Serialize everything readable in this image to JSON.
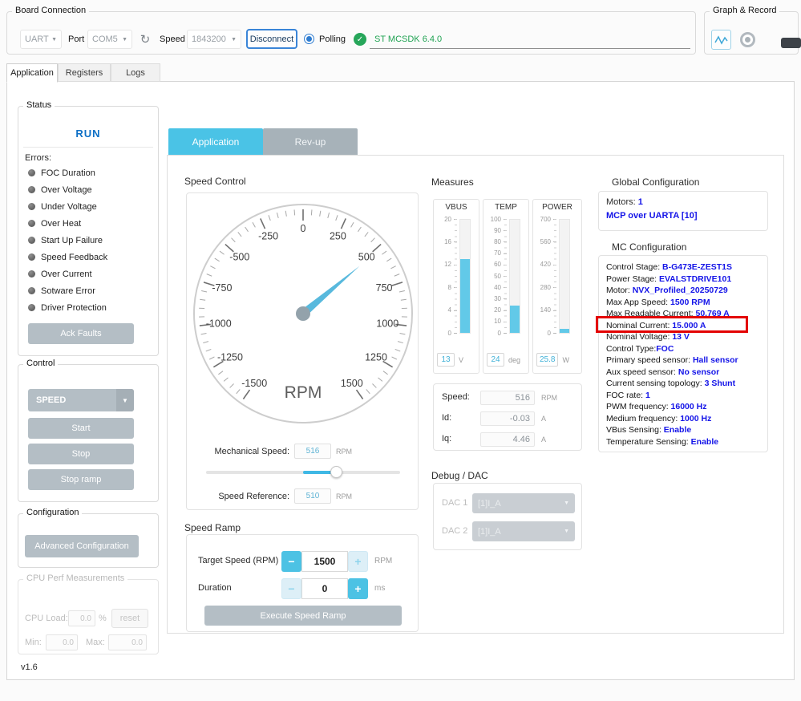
{
  "board_connection": {
    "title": "Board Connection",
    "uart": "UART",
    "port_label": "Port",
    "port_value": "COM5",
    "speed_label": "Speed",
    "speed_value": "1843200",
    "disconnect": "Disconnect",
    "polling": "Polling",
    "firmware": "ST MCSDK 6.4.0"
  },
  "graph_record": {
    "title": "Graph & Record"
  },
  "main_tabs": [
    {
      "label": "Application"
    },
    {
      "label": "Registers"
    },
    {
      "label": "Logs"
    }
  ],
  "status": {
    "title": "Status",
    "state": "RUN",
    "errors_label": "Errors:",
    "errors": [
      "FOC Duration",
      "Over Voltage",
      "Under Voltage",
      "Over Heat",
      "Start Up Failure",
      "Speed Feedback",
      "Over Current",
      "Sotware Error",
      "Driver Protection"
    ],
    "ack_button": "Ack Faults"
  },
  "control": {
    "title": "Control",
    "mode": "SPEED",
    "start": "Start",
    "stop": "Stop",
    "stop_ramp": "Stop ramp"
  },
  "configuration": {
    "title": "Configuration",
    "advanced_button": "Advanced Configuration"
  },
  "cpu_perf": {
    "title": "CPU Perf Measurements",
    "load_label": "CPU Load:",
    "load_value": "0.0",
    "percent": "%",
    "reset": "reset",
    "min_label": "Min:",
    "min_value": "0.0",
    "max_label": "Max:",
    "max_value": "0.0"
  },
  "version": "v1.6",
  "center_tabs": [
    {
      "label": "Application"
    },
    {
      "label": "Rev-up"
    }
  ],
  "speed_control": {
    "title": "Speed Control",
    "gauge": {
      "type": "gauge",
      "min": -1500,
      "max": 1500,
      "major_step": 250,
      "minor_step": 50,
      "start_angle": -145,
      "end_angle": 145,
      "value": 516,
      "unit": "RPM"
    },
    "mech_label": "Mechanical Speed:",
    "mech_value": "516",
    "mech_unit": "RPM",
    "ref_label": "Speed Reference:",
    "ref_value": "510",
    "ref_unit": "RPM",
    "slider": {
      "min": -1500,
      "max": 1500,
      "value": 510
    }
  },
  "speed_ramp": {
    "title": "Speed Ramp",
    "target_label": "Target Speed (RPM)",
    "target_value": "1500",
    "target_unit": "RPM",
    "duration_label": "Duration",
    "duration_value": "0",
    "duration_unit": "ms",
    "execute": "Execute Speed Ramp",
    "minus": "−",
    "plus": "+"
  },
  "measures": {
    "title": "Measures",
    "gauges": [
      {
        "title": "VBUS",
        "max": 20,
        "ticks": [
          20,
          16,
          12,
          8,
          4,
          0
        ],
        "value": 13,
        "unit": "V",
        "display": "13"
      },
      {
        "title": "TEMP",
        "max": 100,
        "ticks": [
          100,
          90,
          80,
          70,
          60,
          50,
          40,
          30,
          20,
          10,
          0
        ],
        "value": 24,
        "unit": "deg",
        "display": "24"
      },
      {
        "title": "POWER",
        "max": 700,
        "ticks": [
          700,
          560,
          420,
          280,
          140,
          0
        ],
        "value": 25.8,
        "unit": "W",
        "display": "25.8"
      }
    ],
    "readouts": [
      {
        "label": "Speed:",
        "value": "516",
        "unit": "RPM"
      },
      {
        "label": "Id:",
        "value": "-0.03",
        "unit": "A"
      },
      {
        "label": "Iq:",
        "value": "4.46",
        "unit": "A"
      }
    ]
  },
  "debug_dac": {
    "title": "Debug / DAC",
    "rows": [
      {
        "label": "DAC 1",
        "value": "[1]I_A"
      },
      {
        "label": "DAC 2",
        "value": "[1]I_A"
      }
    ]
  },
  "global_config": {
    "title": "Global Configuration",
    "motors_label": "Motors: ",
    "motors_value": "1",
    "mcp": "MCP over UARTA [10]"
  },
  "mc_config": {
    "title": "MC Configuration",
    "items": [
      {
        "label": "Control Stage: ",
        "value": "B-G473E-ZEST1S"
      },
      {
        "label": "Power Stage: ",
        "value": "EVALSTDRIVE101"
      },
      {
        "label": "Motor: ",
        "value": "NVX_Profiled_20250729"
      },
      {
        "label": "Max App Speed: ",
        "value": "1500 RPM"
      },
      {
        "label": "Max Readable Current: ",
        "value": "50.769 A"
      },
      {
        "label": "Nominal Current: ",
        "value": "15.000 A"
      },
      {
        "label": "Nominal Voltage: ",
        "value": "13 V"
      },
      {
        "label": "Control Type:",
        "value": "FOC"
      },
      {
        "label": "Primary speed sensor: ",
        "value": "Hall sensor"
      },
      {
        "label": "Aux speed sensor: ",
        "value": "No sensor"
      },
      {
        "label": "Current sensing topology: ",
        "value": "3 Shunt"
      },
      {
        "label": "FOC rate: ",
        "value": "1"
      },
      {
        "label": "PWM frequency: ",
        "value": "16000 Hz"
      },
      {
        "label": "Medium frequency: ",
        "value": "1000 Hz"
      },
      {
        "label": "VBus Sensing: ",
        "value": "Enable"
      },
      {
        "label": "Temperature Sensing: ",
        "value": "Enable"
      }
    ]
  },
  "colors": {
    "accent_cyan": "#4ac3e6",
    "value_blue": "#1414e8",
    "run_blue": "#0e70c6",
    "green": "#21a353",
    "button_gray": "#b4bec5",
    "annotation_red": "#e30000"
  }
}
